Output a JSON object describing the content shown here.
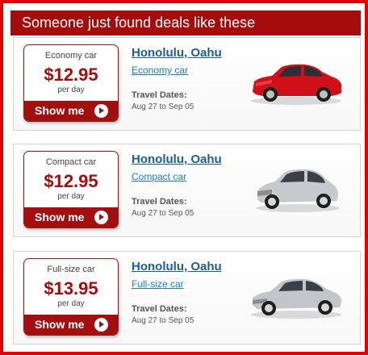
{
  "header": {
    "title": "Someone just found deals like these"
  },
  "deals": [
    {
      "car_class": "Economy car",
      "price": "$12.95",
      "per": "per day",
      "button": "Show me",
      "city": "Honolulu, Oahu",
      "car_link": "Economy car",
      "dates_label": "Travel Dates:",
      "dates": "Aug 27 to Sep 05",
      "car_color": "#d0101a",
      "icon": "economy-car-image"
    },
    {
      "car_class": "Compact car",
      "price": "$12.95",
      "per": "per day",
      "button": "Show me",
      "city": "Honolulu, Oahu",
      "car_link": "Compact car",
      "dates_label": "Travel Dates:",
      "dates": "Aug 27 to Sep 05",
      "car_color": "#c9ccd0",
      "icon": "compact-car-image"
    },
    {
      "car_class": "Full-size car",
      "price": "$13.95",
      "per": "per day",
      "button": "Show me",
      "city": "Honolulu, Oahu",
      "car_link": "Full-size car",
      "dates_label": "Travel Dates:",
      "dates": "Aug 27 to Sep 05",
      "car_color": "#c4c7cc",
      "icon": "fullsize-car-image"
    }
  ],
  "colors": {
    "border": "#e30000",
    "header_bg": "#a50d0d",
    "price": "#a50d0d",
    "link": "#1b5d9c"
  }
}
